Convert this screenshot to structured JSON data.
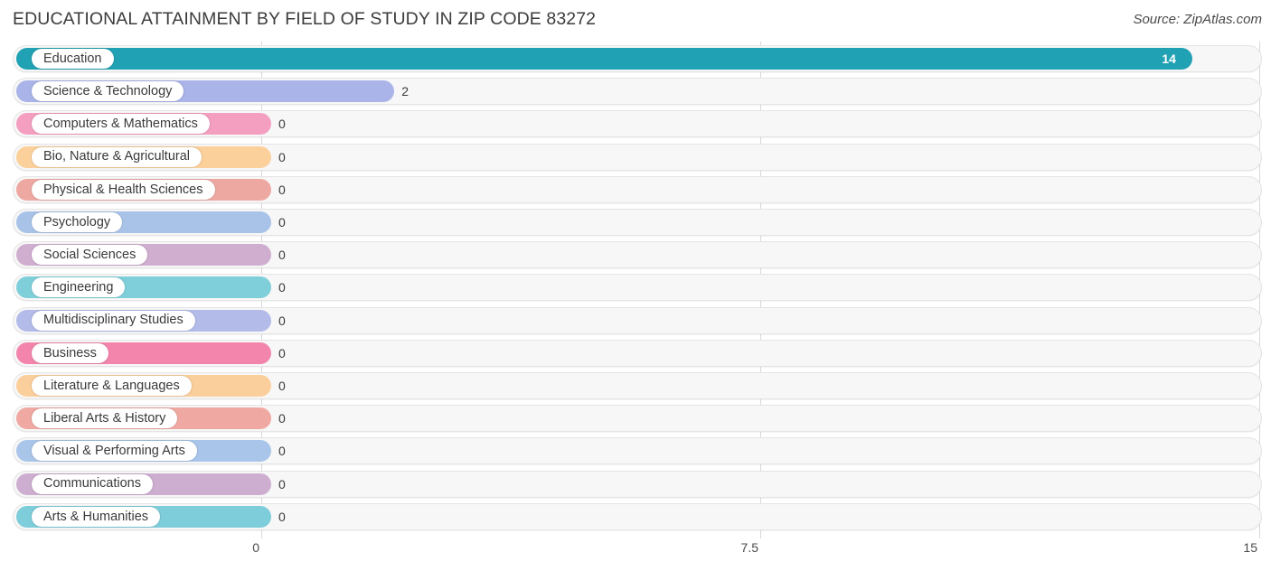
{
  "header": {
    "title": "EDUCATIONAL ATTAINMENT BY FIELD OF STUDY IN ZIP CODE 83272",
    "source": "Source: ZipAtlas.com"
  },
  "chart_data": {
    "type": "bar",
    "orientation": "horizontal",
    "title": "EDUCATIONAL ATTAINMENT BY FIELD OF STUDY IN ZIP CODE 83272",
    "subtitle": "",
    "xlabel": "",
    "ylabel": "",
    "xlim": [
      0,
      15
    ],
    "xticks": [
      "0",
      "7.5",
      "15"
    ],
    "xtick_values": [
      0,
      7.5,
      15
    ],
    "grid": true,
    "legend": false,
    "categories": [
      "Education",
      "Science & Technology",
      "Computers & Mathematics",
      "Bio, Nature & Agricultural",
      "Physical & Health Sciences",
      "Psychology",
      "Social Sciences",
      "Engineering",
      "Multidisciplinary Studies",
      "Business",
      "Literature & Languages",
      "Liberal Arts & History",
      "Visual & Performing Arts",
      "Communications",
      "Arts & Humanities"
    ],
    "values": [
      14,
      2,
      0,
      0,
      0,
      0,
      0,
      0,
      0,
      0,
      0,
      0,
      0,
      0,
      0
    ],
    "value_labels": [
      "14",
      "2",
      "0",
      "0",
      "0",
      "0",
      "0",
      "0",
      "0",
      "0",
      "0",
      "0",
      "0",
      "0",
      "0"
    ],
    "colors": [
      "#21a2b4",
      "#aab4e8",
      "#f49ec0",
      "#fbd09a",
      "#eea8a2",
      "#a9c3e8",
      "#cfaed0",
      "#7fcfda",
      "#b3bbe9",
      "#f385ad",
      "#fbcf9b",
      "#efa9a2",
      "#a9c5e9",
      "#cdaed0",
      "#7ecddb"
    ]
  },
  "bars": [
    {
      "label": "Education",
      "value": 14,
      "value_label": "14",
      "color": "#21a2b4",
      "label_inside": true
    },
    {
      "label": "Science & Technology",
      "value": 2,
      "value_label": "2",
      "color": "#aab4e8",
      "label_inside": false
    },
    {
      "label": "Computers & Mathematics",
      "value": 0,
      "value_label": "0",
      "color": "#f49ec0",
      "label_inside": false
    },
    {
      "label": "Bio, Nature & Agricultural",
      "value": 0,
      "value_label": "0",
      "color": "#fbd09a",
      "label_inside": false
    },
    {
      "label": "Physical & Health Sciences",
      "value": 0,
      "value_label": "0",
      "color": "#eea8a2",
      "label_inside": false
    },
    {
      "label": "Psychology",
      "value": 0,
      "value_label": "0",
      "color": "#a9c3e8",
      "label_inside": false
    },
    {
      "label": "Social Sciences",
      "value": 0,
      "value_label": "0",
      "color": "#cfaed0",
      "label_inside": false
    },
    {
      "label": "Engineering",
      "value": 0,
      "value_label": "0",
      "color": "#7fcfda",
      "label_inside": false
    },
    {
      "label": "Multidisciplinary Studies",
      "value": 0,
      "value_label": "0",
      "color": "#b3bbe9",
      "label_inside": false
    },
    {
      "label": "Business",
      "value": 0,
      "value_label": "0",
      "color": "#f385ad",
      "label_inside": false
    },
    {
      "label": "Literature & Languages",
      "value": 0,
      "value_label": "0",
      "color": "#fbcf9b",
      "label_inside": false
    },
    {
      "label": "Liberal Arts & History",
      "value": 0,
      "value_label": "0",
      "color": "#efa9a2",
      "label_inside": false
    },
    {
      "label": "Visual & Performing Arts",
      "value": 0,
      "value_label": "0",
      "color": "#a9c5e9",
      "label_inside": false
    },
    {
      "label": "Communications",
      "value": 0,
      "value_label": "0",
      "color": "#cdaed0",
      "label_inside": false
    },
    {
      "label": "Arts & Humanities",
      "value": 0,
      "value_label": "0",
      "color": "#7ecddb",
      "label_inside": false
    }
  ],
  "axis": {
    "ticks": [
      "0",
      "7.5",
      "15"
    ]
  }
}
